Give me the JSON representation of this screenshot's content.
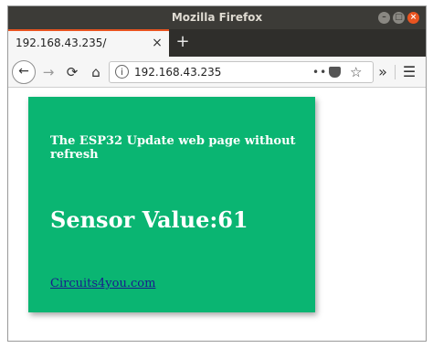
{
  "window": {
    "title": "Mozilla Firefox",
    "controls": {
      "minimize": "–",
      "maximize": "□",
      "close": "×"
    }
  },
  "tab": {
    "title": "192.168.43.235/",
    "close": "×"
  },
  "tabbar": {
    "new_tab": "+"
  },
  "navbar": {
    "back": "←",
    "forward": "→",
    "reload": "⟳",
    "home": "⌂",
    "url": "192.168.43.235",
    "info_icon": "i",
    "page_actions": "•••",
    "bookmark": "☆",
    "overflow": "»",
    "menu": "☰"
  },
  "page": {
    "heading": "The ESP32 Update web page without refresh",
    "sensor_label": "Sensor Value:",
    "sensor_value": "61",
    "link_text": "Circuits4you.com"
  },
  "colors": {
    "card_bg": "#0ab572",
    "titlebar": "#3c3b37",
    "accent": "#e95420",
    "link": "#1a1a8c"
  }
}
